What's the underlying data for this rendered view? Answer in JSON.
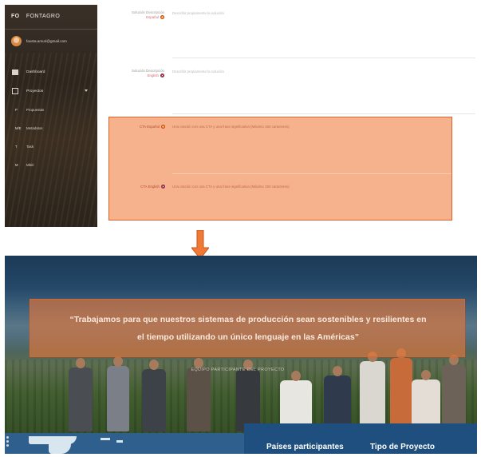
{
  "admin": {
    "brand_abbr": "FO",
    "brand_name": "FONTAGRO",
    "user_email": "fausta.amuri@gmail.com",
    "nav": [
      {
        "label": "Dashboard"
      },
      {
        "label": "Proyectos"
      }
    ],
    "sub_nav": [
      {
        "abbr": "P",
        "label": "Propuestas"
      },
      {
        "abbr": "M/E",
        "label": "Metadatos"
      },
      {
        "abbr": "T",
        "label": "Task"
      },
      {
        "abbr": "M",
        "label": "Mbiri"
      }
    ],
    "fields": [
      {
        "label": "Solución Descripción",
        "lang": "Español",
        "placeholder": "Describir propiamente la solución"
      },
      {
        "label": "Solución Descripción",
        "lang": "English",
        "placeholder": "Describir propiamente la solución"
      }
    ],
    "highlighted_fields": [
      {
        "label": "CTA Español",
        "placeholder": "Una oración con una CTA y una frase significativa (Máximo 150 caracteres)"
      },
      {
        "label": "CTA English",
        "placeholder": "Una oración con una CTA y una frase significativa (Máximo 150 caracteres)"
      }
    ]
  },
  "colors": {
    "highlight": "#F08246",
    "highlight_border": "#E0632A",
    "sidebar_bg": "#2C261F",
    "info_bar": "#1F4F7E"
  },
  "site": {
    "quote_line1": "“Trabajamos para que nuestros sistemas de producción sean sostenibles y resilientes en",
    "quote_line2": "el tiempo utilizando un único lenguaje en las Américas”",
    "subtitle": "EQUIPO PARTICIPANTE DEL PROYECTO",
    "info_titles": [
      "Países participantes",
      "Tipo de Proyecto"
    ]
  }
}
